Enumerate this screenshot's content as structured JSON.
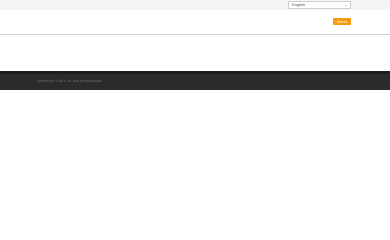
{
  "language_selector": {
    "selected": "English",
    "icon": "chevron-down-icon"
  },
  "header": {
    "menu_label": "Menu",
    "accent_color": "#f39c12"
  },
  "footer": {
    "copyright": "COPYRIGHT © 2017. ALL RIGHTS RESERVED."
  }
}
